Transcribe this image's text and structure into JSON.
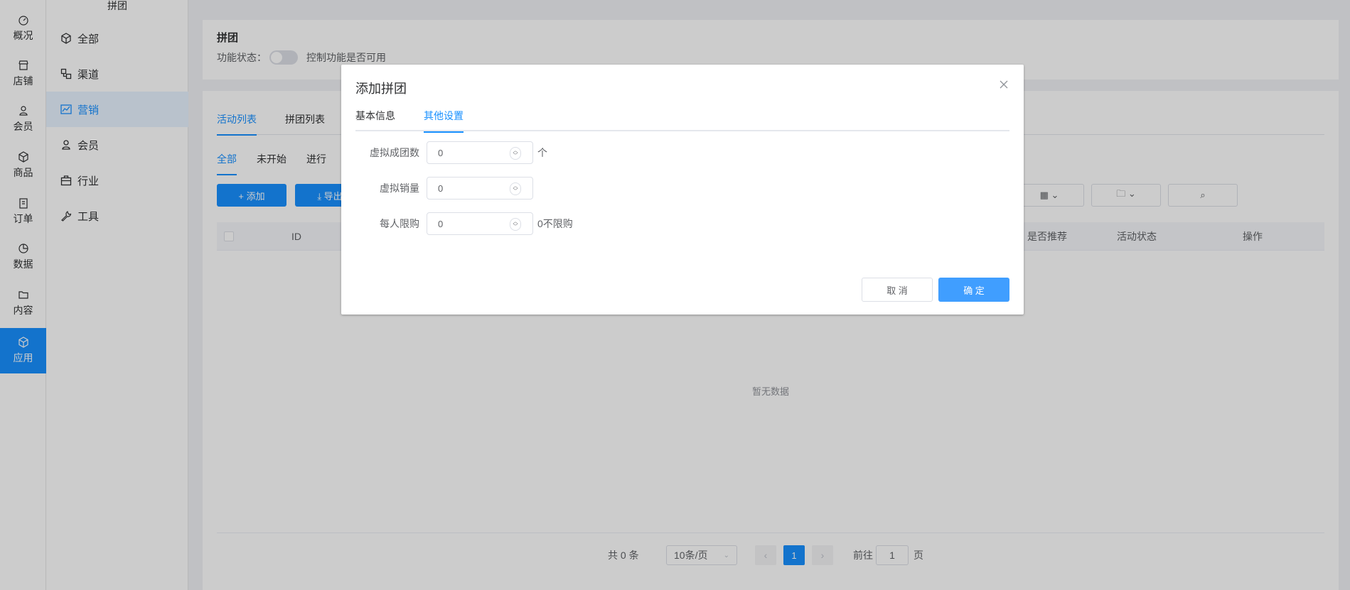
{
  "rail": {
    "items": [
      {
        "label": "概况",
        "icon": "dashboard-icon"
      },
      {
        "label": "店铺",
        "icon": "store-icon"
      },
      {
        "label": "会员",
        "icon": "user-icon"
      },
      {
        "label": "商品",
        "icon": "box-icon"
      },
      {
        "label": "订单",
        "icon": "clipboard-icon"
      },
      {
        "label": "数据",
        "icon": "pie-chart-icon"
      },
      {
        "label": "内容",
        "icon": "folder-icon"
      },
      {
        "label": "应用",
        "icon": "cube-icon"
      }
    ],
    "active_index": 7
  },
  "subnav": {
    "title": "拼团",
    "items": [
      {
        "label": "全部",
        "icon": "cube-icon"
      },
      {
        "label": "渠道",
        "icon": "channel-icon"
      },
      {
        "label": "营销",
        "icon": "trend-icon"
      },
      {
        "label": "会员",
        "icon": "user-icon"
      },
      {
        "label": "行业",
        "icon": "briefcase-icon"
      },
      {
        "label": "工具",
        "icon": "wrench-icon"
      }
    ],
    "active_index": 2
  },
  "header": {
    "title": "拼团",
    "status_label": "功能状态：",
    "status_desc": "控制功能是否可用"
  },
  "main_tabs": [
    "活动列表",
    "拼团列表"
  ],
  "filter_tabs": [
    "全部",
    "未开始",
    "进行"
  ],
  "toolbar": {
    "add_label": "+ 添加",
    "export_label": "⤓ 导出"
  },
  "table": {
    "columns": [
      "ID",
      "是否推荐",
      "活动状态",
      "操作"
    ],
    "empty_text": "暂无数据"
  },
  "pagination": {
    "total": "共 0 条",
    "page_size": "10条/页",
    "current_page": "1",
    "goto_prefix": "前往",
    "goto_value": "1",
    "goto_suffix": "页"
  },
  "dialog": {
    "title": "添加拼团",
    "tabs": [
      "基本信息",
      "其他设置"
    ],
    "active_tab": 1,
    "fields": [
      {
        "label": "虚拟成团数",
        "value": "0",
        "suffix": "个"
      },
      {
        "label": "虚拟销量",
        "value": "0",
        "suffix": ""
      },
      {
        "label": "每人限购",
        "value": "0",
        "suffix": "0不限购"
      }
    ],
    "cancel_label": "取 消",
    "ok_label": "确 定"
  },
  "colors": {
    "primary": "#1890ff",
    "dialog_ok": "#409eff"
  }
}
